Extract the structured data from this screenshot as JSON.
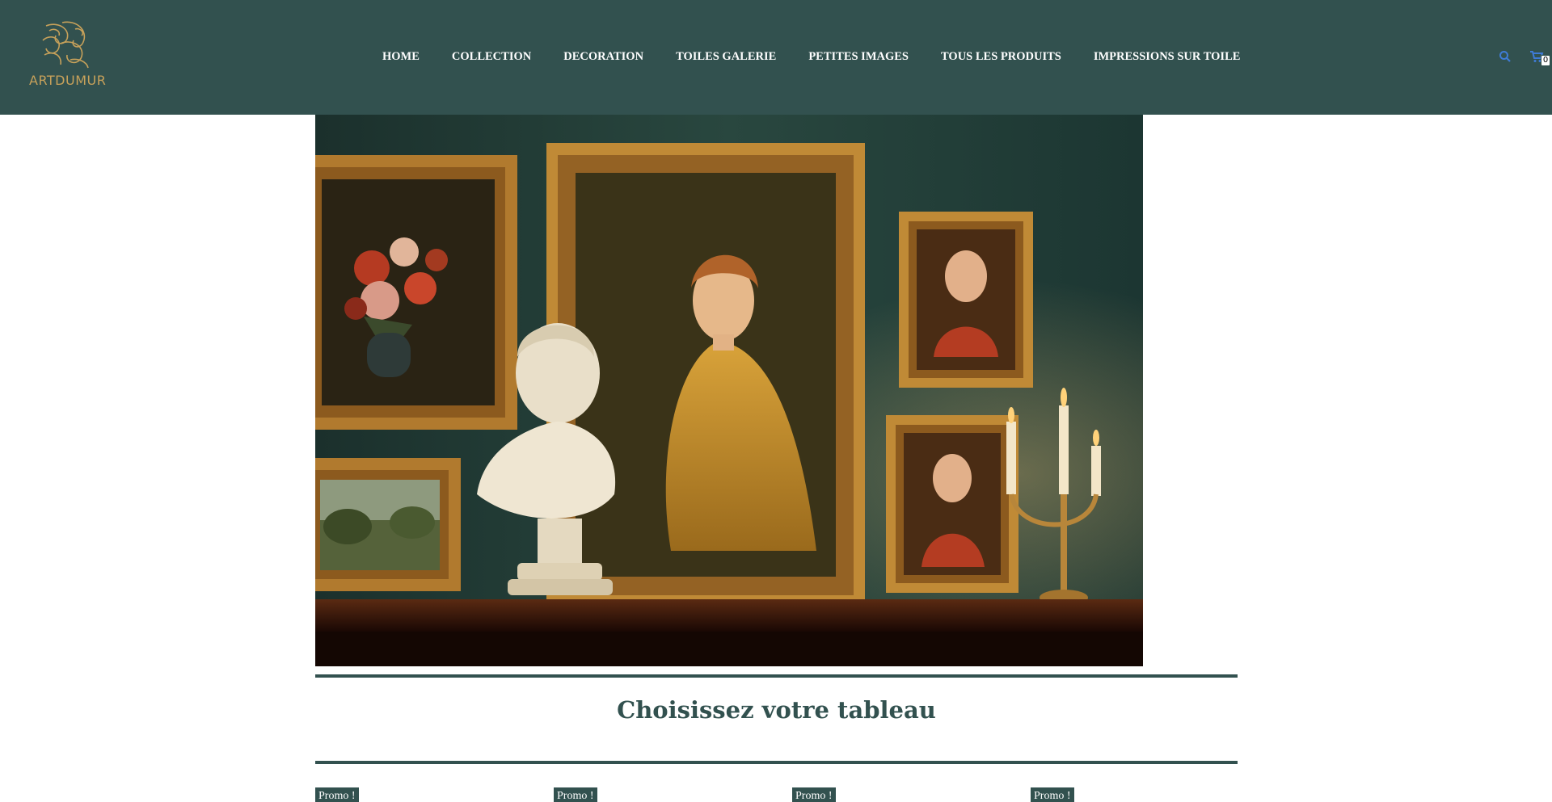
{
  "header": {
    "brand": "ARTDUMUR",
    "nav": [
      "HOME",
      "COLLECTION",
      "DECORATION",
      "TOILES GALERIE",
      "PETITES IMAGES",
      "TOUS LES PRODUITS",
      "IMPRESSIONS SUR TOILE"
    ],
    "cart_count": "0",
    "icons": {
      "search": "search-icon",
      "cart": "cart-icon",
      "logo": "swirl-logo-icon"
    }
  },
  "main": {
    "section_title": "Choisissez votre tableau",
    "products": [
      {
        "badge": "Promo !"
      },
      {
        "badge": "Promo !"
      },
      {
        "badge": "Promo !"
      },
      {
        "badge": "Promo !"
      }
    ]
  },
  "colors": {
    "header_bg": "#32514f",
    "accent": "#32514f",
    "gold": "#c7a15a",
    "icon_blue": "#3e7bd6"
  }
}
